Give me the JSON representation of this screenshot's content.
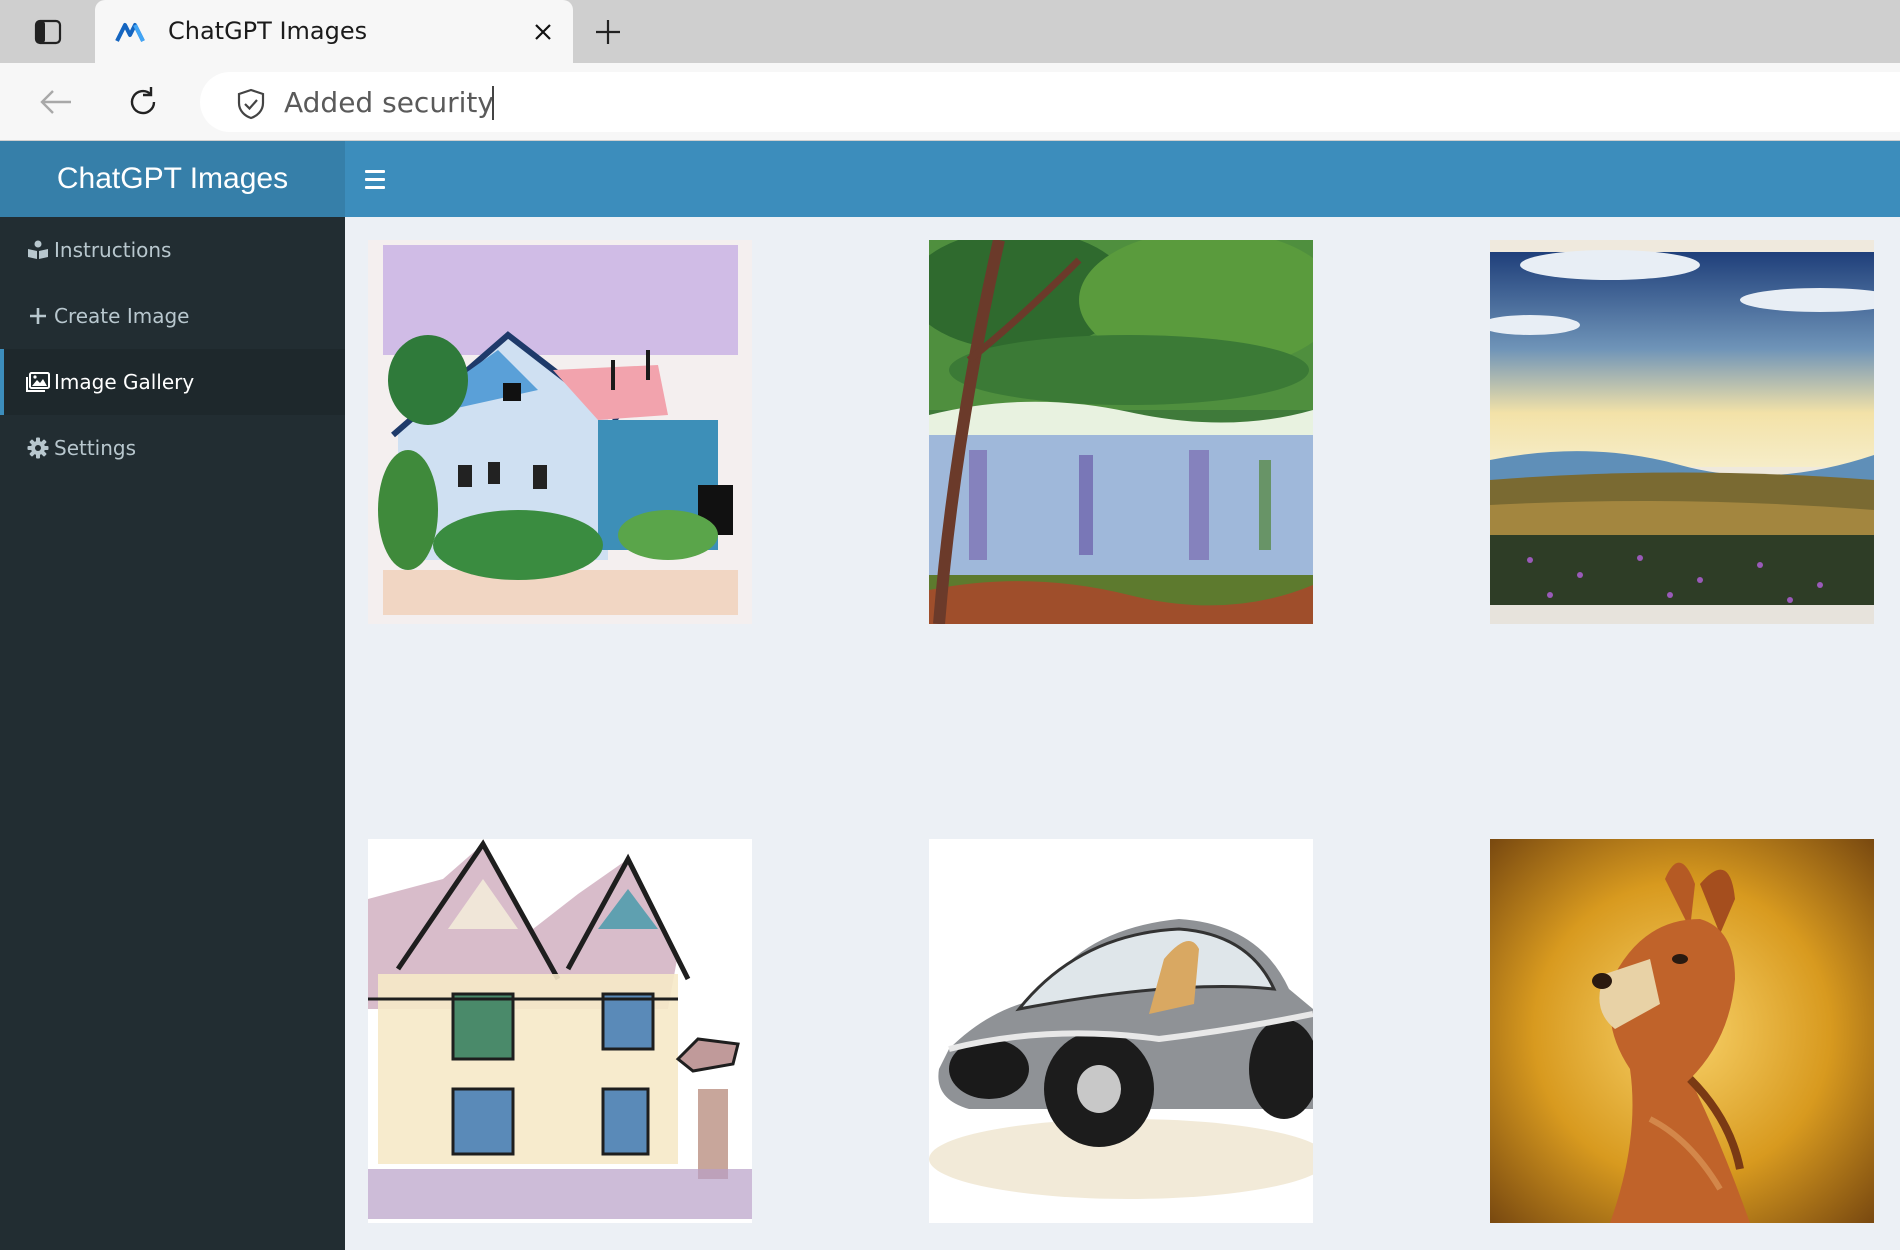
{
  "browser": {
    "tab_title": "ChatGPT Images",
    "security_label": "Added security",
    "icons": {
      "tab_actions": "tab-actions-icon",
      "favicon": "favicon-icon",
      "close": "close-icon",
      "new_tab": "plus-icon",
      "back": "back-arrow-icon",
      "reload": "reload-icon",
      "shield": "shield-icon"
    }
  },
  "app": {
    "brand": "ChatGPT Images",
    "colors": {
      "header_brand": "#367fa9",
      "header_bar": "#3c8dbc",
      "sidebar": "#222d32",
      "sidebar_active": "#1e282c",
      "content_bg": "#ecf0f5"
    },
    "sidebar": {
      "items": [
        {
          "label": "Instructions",
          "icon": "book-reader-icon"
        },
        {
          "label": "Create Image",
          "icon": "plus-icon"
        },
        {
          "label": "Image Gallery",
          "icon": "image-icon",
          "active": true
        },
        {
          "label": "Settings",
          "icon": "gear-icon"
        }
      ]
    },
    "gallery": {
      "images": [
        {
          "subject": "watercolor house"
        },
        {
          "subject": "river landscape painting"
        },
        {
          "subject": "sunset field painting"
        },
        {
          "subject": "watercolor townhouses"
        },
        {
          "subject": "futuristic car"
        },
        {
          "subject": "kangaroo painting"
        }
      ]
    }
  }
}
